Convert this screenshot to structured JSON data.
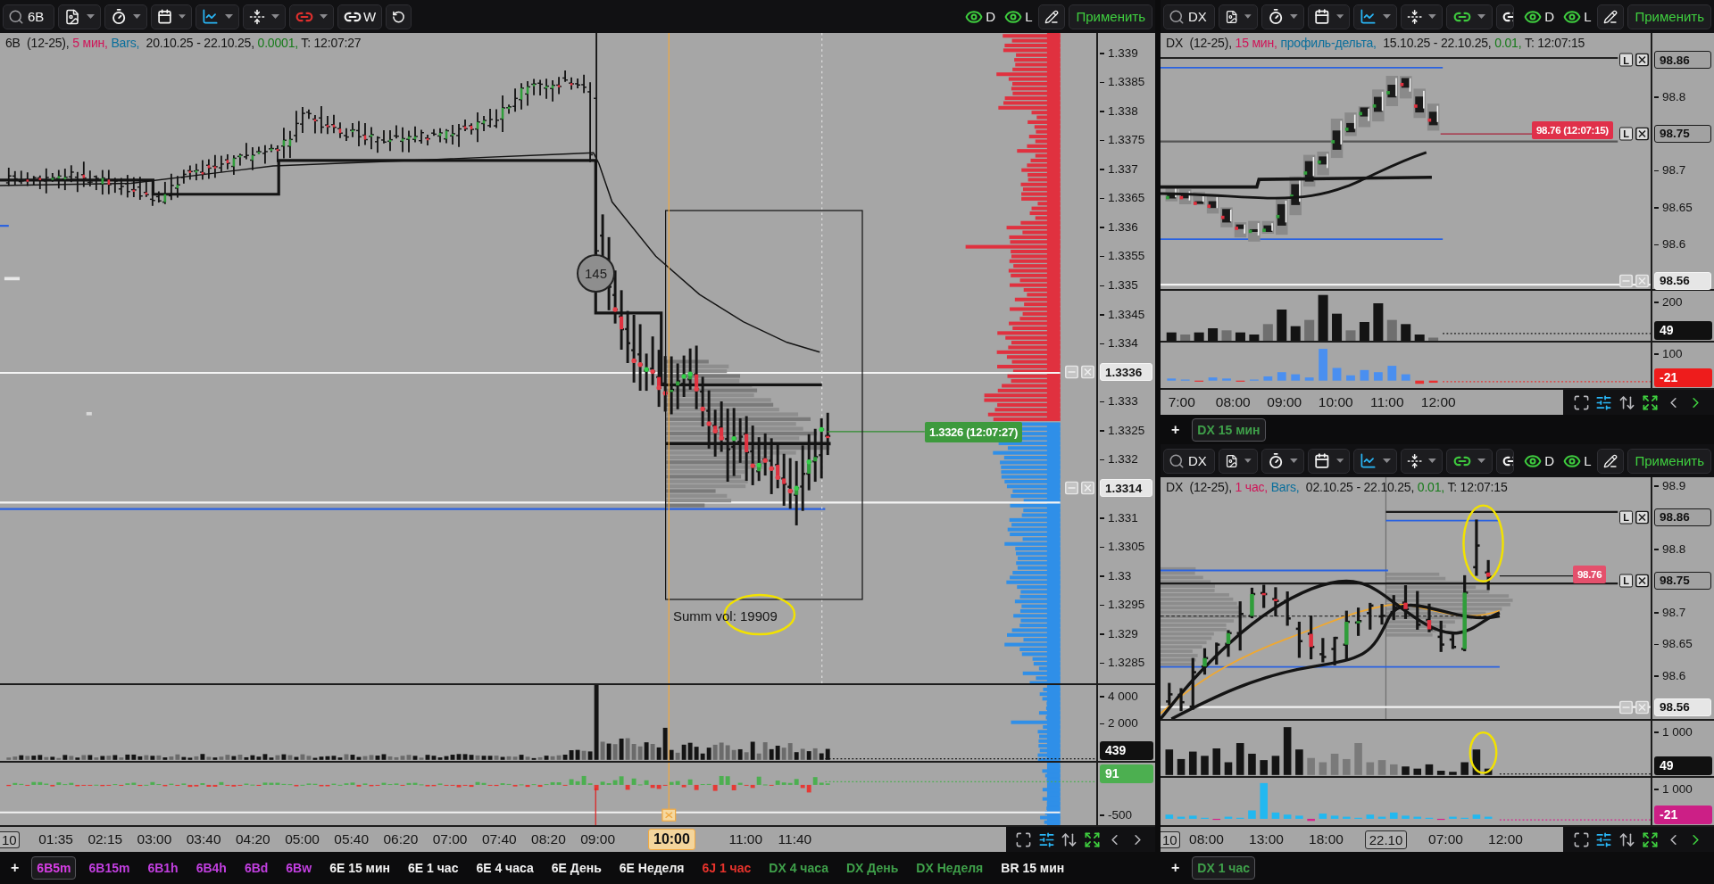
{
  "panels": [
    {
      "toolbar": {
        "symbol": "6B",
        "link": {
          "color": "#e0302e",
          "label": "W"
        },
        "undo": true,
        "views": [
          {
            "label": "D",
            "on": true
          },
          {
            "label": "L",
            "on": true
          }
        ],
        "apply": "Применить"
      },
      "info": {
        "symbol": "6B  (12-25),",
        "timeframe": "5 мин,",
        "style": "Bars,",
        "range": "20.10.25 - 22.10.25,",
        "step": "0.0001,",
        "time": "T: 12:07:27"
      },
      "price_axis": [
        {
          "text": "1.339",
          "kind": "tick"
        },
        {
          "text": "1.3385",
          "kind": "tick"
        },
        {
          "text": "1.338",
          "kind": "tick"
        },
        {
          "text": "1.3375",
          "kind": "tick"
        },
        {
          "text": "1.337",
          "kind": "tick"
        },
        {
          "text": "1.3365",
          "kind": "tick"
        },
        {
          "text": "1.336",
          "kind": "tick"
        },
        {
          "text": "1.3355",
          "kind": "tick"
        },
        {
          "text": "1.335",
          "kind": "tick"
        },
        {
          "text": "1.3345",
          "kind": "tick"
        },
        {
          "text": "1.334",
          "kind": "tick"
        },
        {
          "text": "1.3336",
          "kind": "level"
        },
        {
          "text": "1.333",
          "kind": "tick"
        },
        {
          "text": "1.3325",
          "kind": "tick"
        },
        {
          "text": "1.332",
          "kind": "tick"
        },
        {
          "text": "1.3314",
          "kind": "level"
        },
        {
          "text": "1.331",
          "kind": "tick"
        },
        {
          "text": "1.3305",
          "kind": "tick"
        },
        {
          "text": "1.33",
          "kind": "tick"
        },
        {
          "text": "1.3295",
          "kind": "tick"
        },
        {
          "text": "1.329",
          "kind": "tick"
        },
        {
          "text": "1.3285",
          "kind": "tick"
        }
      ],
      "current_price": {
        "text": "1.3326 (12:07:27)",
        "color": "#3d9a3d"
      },
      "note": "Summ vol: 19909",
      "marker": "145",
      "volume_axis": [
        {
          "text": "4 000",
          "kind": "tick"
        },
        {
          "text": "2 000",
          "kind": "tick"
        },
        {
          "text": "439",
          "kind": "badge",
          "color": "#111111"
        }
      ],
      "delta_axis": [
        {
          "text": "91",
          "kind": "badge",
          "color": "#4caf50"
        },
        {
          "text": "-500",
          "kind": "tick"
        }
      ],
      "time_axis": [
        {
          "text": "10",
          "kind": "edge"
        },
        {
          "text": "01:35",
          "kind": "tick"
        },
        {
          "text": "02:15",
          "kind": "tick"
        },
        {
          "text": "03:00",
          "kind": "tick"
        },
        {
          "text": "03:40",
          "kind": "tick"
        },
        {
          "text": "04:20",
          "kind": "tick"
        },
        {
          "text": "05:00",
          "kind": "tick"
        },
        {
          "text": "05:40",
          "kind": "tick"
        },
        {
          "text": "06:20",
          "kind": "tick"
        },
        {
          "text": "07:00",
          "kind": "tick"
        },
        {
          "text": "07:40",
          "kind": "tick"
        },
        {
          "text": "08:20",
          "kind": "tick"
        },
        {
          "text": "09:00",
          "kind": "tick"
        },
        {
          "text": "10:00",
          "kind": "cursor"
        },
        {
          "text": "11:00",
          "kind": "tick"
        },
        {
          "text": "11:40",
          "kind": "tick"
        }
      ],
      "auto_scroll": false,
      "tabs": {
        "add": "+",
        "items": [
          {
            "label": "6B5m",
            "color": "#d83ee6",
            "selected": true
          },
          {
            "label": "6B15m",
            "color": "#c23fe0",
            "selected": false
          },
          {
            "label": "6B1h",
            "color": "#c23fe0",
            "selected": false
          },
          {
            "label": "6B4h",
            "color": "#c23fe0",
            "selected": false
          },
          {
            "label": "6Bd",
            "color": "#c23fe0",
            "selected": false
          },
          {
            "label": "6Bw",
            "color": "#c23fe0",
            "selected": false
          },
          {
            "label": "6E 15 мин",
            "color": "#f2f2f2",
            "selected": false
          },
          {
            "label": "6E 1 час",
            "color": "#f2f2f2",
            "selected": false
          },
          {
            "label": "6E 4 часа",
            "color": "#f2f2f2",
            "selected": false
          },
          {
            "label": "6E День",
            "color": "#f2f2f2",
            "selected": false
          },
          {
            "label": "6E Неделя",
            "color": "#f2f2f2",
            "selected": false
          },
          {
            "label": "6J 1 час",
            "color": "#e8332c",
            "selected": false
          },
          {
            "label": "DX 4 часа",
            "color": "#3fa04a",
            "selected": false
          },
          {
            "label": "DX День",
            "color": "#3fa04a",
            "selected": false
          },
          {
            "label": "DX Неделя",
            "color": "#3fa04a",
            "selected": false
          },
          {
            "label": "BR 15 мин",
            "color": "#f2f2f2",
            "selected": false
          }
        ]
      }
    },
    {
      "toolbar": {
        "symbol": "DX",
        "link": {
          "color": "#3ec93e"
        },
        "undo": false,
        "views": [
          {
            "label": "D",
            "on": true
          },
          {
            "label": "L",
            "on": true
          }
        ],
        "apply": "Применить"
      },
      "info": {
        "symbol": "DX  (12-25),",
        "timeframe": "15 мин,",
        "style": "профиль-дельта,",
        "range": "15.10.25 - 22.10.25,",
        "step": "0.01,",
        "time": "T: 12:07:15"
      },
      "price_axis": [
        {
          "text": "98.86",
          "kind": "alert",
          "tag": "L"
        },
        {
          "text": "98.8",
          "kind": "tick"
        },
        {
          "text": "98.75",
          "kind": "alert",
          "tag": "L"
        },
        {
          "text": "98.7",
          "kind": "tick"
        },
        {
          "text": "98.65",
          "kind": "tick"
        },
        {
          "text": "98.6",
          "kind": "tick"
        },
        {
          "text": "98.56",
          "kind": "level"
        }
      ],
      "current_price": {
        "text": "98.76 (12:07:15)",
        "color": "#e0304a"
      },
      "volume_axis": [
        {
          "text": "200",
          "kind": "tick"
        },
        {
          "text": "49",
          "kind": "badge",
          "color": "#111111"
        }
      ],
      "delta_axis": [
        {
          "text": "100",
          "kind": "tick"
        },
        {
          "text": "-21",
          "kind": "badge",
          "color": "#ee1c1c"
        }
      ],
      "time_axis": [
        {
          "text": "7:00",
          "kind": "tick"
        },
        {
          "text": "08:00",
          "kind": "tick"
        },
        {
          "text": "09:00",
          "kind": "tick"
        },
        {
          "text": "10:00",
          "kind": "tick"
        },
        {
          "text": "11:00",
          "kind": "tick"
        },
        {
          "text": "12:00",
          "kind": "tick"
        }
      ],
      "auto_scroll": true,
      "tabs": {
        "add": "+",
        "items": [
          {
            "label": "DX 15 мин",
            "color": "#3fa04a",
            "selected": true
          }
        ]
      }
    },
    {
      "toolbar": {
        "symbol": "DX",
        "link": {
          "color": "#3ec93e"
        },
        "undo": false,
        "views": [
          {
            "label": "D",
            "on": true
          },
          {
            "label": "L",
            "on": true
          }
        ],
        "apply": "Применить"
      },
      "info": {
        "symbol": "DX  (12-25),",
        "timeframe": "1 час,",
        "style": "Bars,",
        "range": "02.10.25 - 22.10.25,",
        "step": "0.01,",
        "time": "T: 12:07:15"
      },
      "price_axis": [
        {
          "text": "98.9",
          "kind": "tick"
        },
        {
          "text": "98.86",
          "kind": "alert",
          "tag": "L"
        },
        {
          "text": "98.8",
          "kind": "tick"
        },
        {
          "text": "98.75",
          "kind": "alert",
          "tag": "L"
        },
        {
          "text": "98.7",
          "kind": "tick"
        },
        {
          "text": "98.65",
          "kind": "tick"
        },
        {
          "text": "98.6",
          "kind": "tick"
        },
        {
          "text": "98.56",
          "kind": "level"
        }
      ],
      "current_price": {
        "text": "98.76",
        "color": "#e4506c"
      },
      "volume_axis": [
        {
          "text": "1 000",
          "kind": "tick"
        },
        {
          "text": "49",
          "kind": "badge",
          "color": "#111111"
        }
      ],
      "delta_axis": [
        {
          "text": "1 000",
          "kind": "tick"
        },
        {
          "text": "-21",
          "kind": "badge",
          "color": "#cc1f86"
        }
      ],
      "time_axis": [
        {
          "text": "10",
          "kind": "edge"
        },
        {
          "text": "08:00",
          "kind": "tick"
        },
        {
          "text": "13:00",
          "kind": "tick"
        },
        {
          "text": "18:00",
          "kind": "tick"
        },
        {
          "text": "22.10",
          "kind": "date"
        },
        {
          "text": "07:00",
          "kind": "tick"
        },
        {
          "text": "12:00",
          "kind": "tick"
        }
      ],
      "auto_scroll": true,
      "tabs": {
        "add": "+",
        "items": [
          {
            "label": "DX 1 час",
            "color": "#3fa04a",
            "selected": true
          }
        ]
      }
    }
  ]
}
